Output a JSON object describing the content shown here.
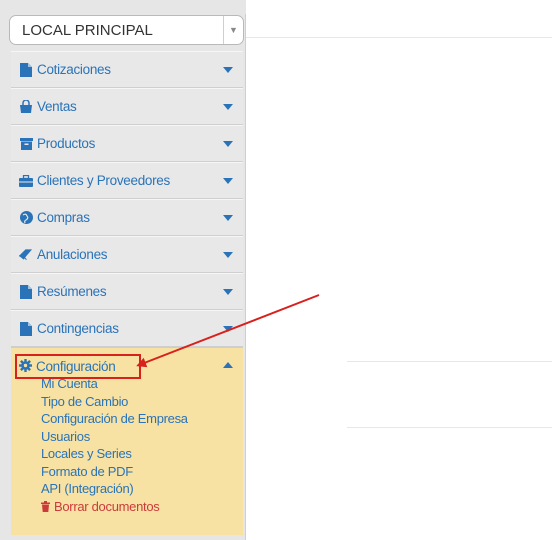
{
  "branch_select": {
    "value": "LOCAL PRINCIPAL"
  },
  "menu": [
    {
      "label": "Cotizaciones",
      "icon": "file-icon"
    },
    {
      "label": "Ventas",
      "icon": "shopping-bag-icon"
    },
    {
      "label": "Productos",
      "icon": "box-icon"
    },
    {
      "label": "Clientes y Proveedores",
      "icon": "briefcase-icon"
    },
    {
      "label": "Compras",
      "icon": "globe-icon"
    },
    {
      "label": "Anulaciones",
      "icon": "eraser-icon"
    },
    {
      "label": "Resúmenes",
      "icon": "file-icon"
    },
    {
      "label": "Contingencias",
      "icon": "file-icon"
    }
  ],
  "config": {
    "label": "Configuración",
    "icon": "gear-icon",
    "items": [
      "Mi Cuenta",
      "Tipo de Cambio",
      "Configuración de Empresa",
      "Usuarios",
      "Locales y Series",
      "Formato de PDF",
      "API (Integración)"
    ],
    "danger_item": "Borrar documentos",
    "danger_icon": "trash-icon"
  },
  "colors": {
    "link": "#2a73b8",
    "active_bg": "#f7e2a3",
    "annotation": "#d8201c",
    "danger": "#cc3b3b"
  }
}
